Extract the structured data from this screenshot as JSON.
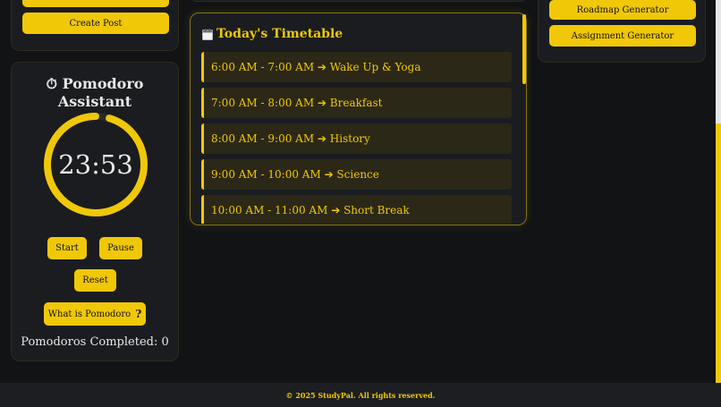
{
  "left_top": {
    "create_post_label": "Create Post"
  },
  "pomodoro": {
    "title": "Pomodoro Assistant",
    "icon": "stopwatch-icon",
    "timer": "23:53",
    "progress": 0.955,
    "start_label": "Start",
    "pause_label": "Pause",
    "reset_label": "Reset",
    "what_is_label": "What is Pomodoro",
    "completed_text": "Pomodoros Completed: 0"
  },
  "timetable": {
    "title": "Today's Timetable",
    "icon": "calendar-icon",
    "items": [
      "6:00 AM - 7:00 AM ➔ Wake Up & Yoga",
      "7:00 AM - 8:00 AM ➔ Breakfast",
      "8:00 AM - 9:00 AM ➔ History",
      "9:00 AM - 10:00 AM ➔ Science",
      "10:00 AM - 11:00 AM ➔ Short Break"
    ]
  },
  "right": {
    "roadmap_label": "Roadmap Generator",
    "assignment_label": "Assignment Generator"
  },
  "footer": {
    "text": "© 2025 StudyPal. All rights reserved."
  },
  "colors": {
    "accent": "#f0c808",
    "background": "#111315",
    "card": "#1a1c1f"
  }
}
